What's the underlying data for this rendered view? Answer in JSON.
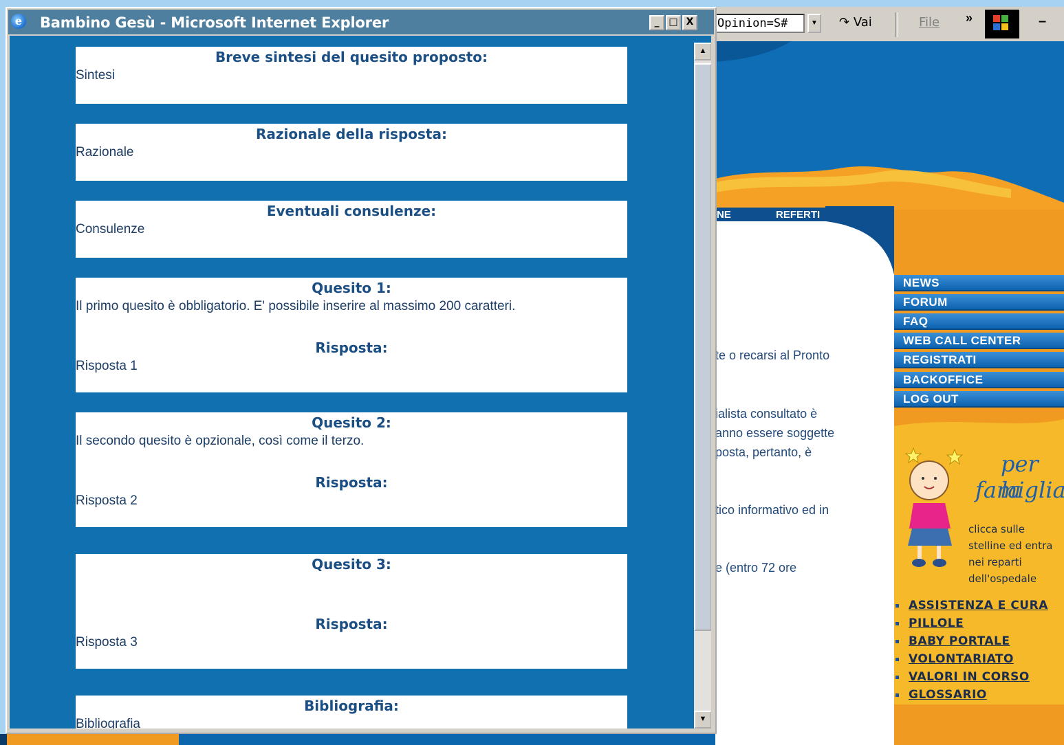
{
  "popup": {
    "window_title": "Bambino Gesù - Microsoft Internet Explorer",
    "controls": {
      "minimize": "_",
      "maximize": "□",
      "close": "X"
    },
    "sections": [
      {
        "title": "Breve sintesi del quesito proposto:",
        "text": "Sintesi"
      },
      {
        "title": "Razionale della risposta:",
        "text": "Razionale"
      },
      {
        "title": "Eventuali consulenze:",
        "text": "Consulenze"
      },
      {
        "title": "Quesito 1:",
        "text": "Il primo quesito è obbligatorio. E' possibile inserire al massimo 200 caratteri.",
        "answer_title": "Risposta:",
        "answer_text": "Risposta 1"
      },
      {
        "title": "Quesito 2:",
        "text": "Il secondo quesito è opzionale, così come il terzo.",
        "answer_title": "Risposta:",
        "answer_text": "Risposta 2"
      },
      {
        "title": "Quesito 3:",
        "text": "",
        "answer_title": "Risposta:",
        "answer_text": "Risposta 3"
      },
      {
        "title": "Bibliografia:",
        "text": "Bibliografia"
      }
    ]
  },
  "background": {
    "address_text": "Opinion=S#",
    "go_label": "Vai",
    "menu_file": "File",
    "chevron": "»",
    "tabs": [
      "NE",
      "REFERTI"
    ],
    "content_fragments": [
      "te o recarsi al Pronto",
      "ialista consultato è",
      "anno essere soggette",
      "posta, pertanto, è",
      "tico informativo ed in",
      "e (entro 72 ore"
    ],
    "nav": [
      "NEWS",
      "FORUM",
      "FAQ",
      "WEB CALL CENTER",
      "REGISTRATI",
      "BACKOFFICE",
      "LOG OUT"
    ],
    "family": {
      "title_line1": "per la",
      "title_line2": "famiglia",
      "caption": [
        "clicca sulle",
        "stelline ed entra",
        "nei reparti",
        "dell'ospedale"
      ],
      "links": [
        "ASSISTENZA E CURA",
        "PILLOLE",
        "BABY PORTALE",
        "VOLONTARIATO",
        "VALORI IN CORSO",
        "GLOSSARIO"
      ]
    }
  },
  "colors": {
    "page_blue": "#0f6db6",
    "orange": "#f19a21",
    "yellow": "#f6b92a",
    "popup_bg": "#1070b0",
    "title_text": "#1b4f84"
  }
}
